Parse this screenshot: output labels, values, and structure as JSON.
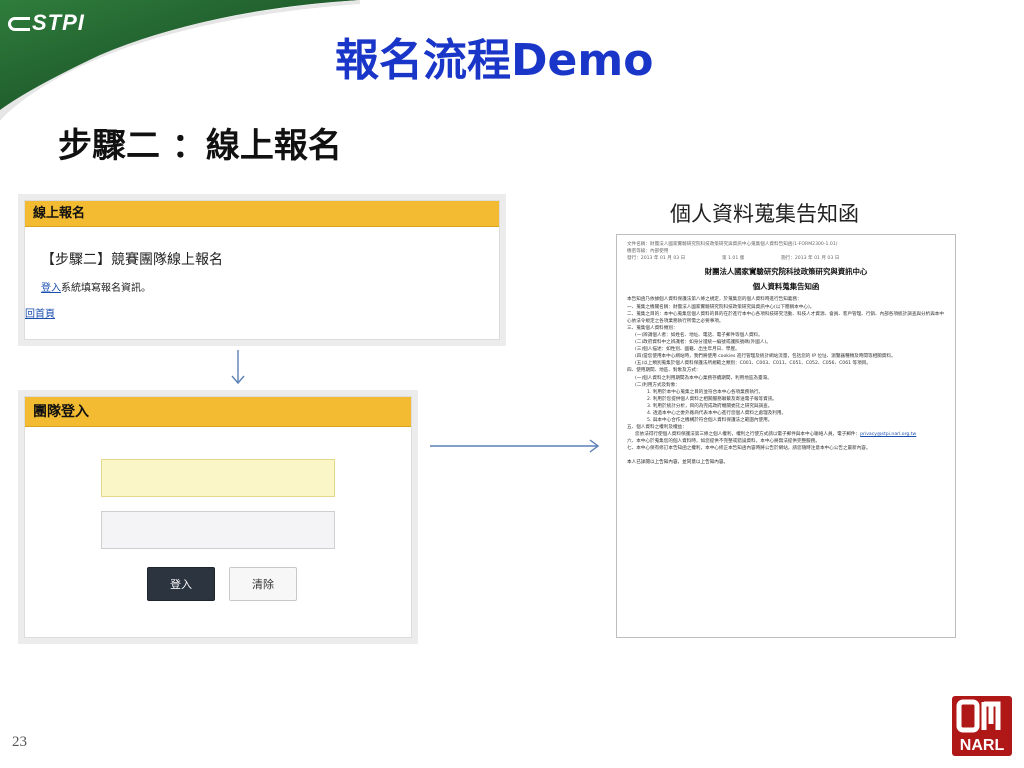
{
  "logo": {
    "text": "STPI"
  },
  "slide": {
    "title": "報名流程Demo",
    "step_title": "步驟二 ：線上報名",
    "page_number": "23"
  },
  "registration_panel": {
    "header": "線上報名",
    "heading": "【步驟二】競賽團隊線上報名",
    "login_link": "登入",
    "instruction": "系統填寫報名資訊。",
    "home_link": "回首頁"
  },
  "login_panel": {
    "header": "團隊登入",
    "username_value": "",
    "password_value": "",
    "login_button": "登入",
    "clear_button": "清除"
  },
  "document": {
    "caption": "個人資料蒐集告知函",
    "meta_line1": "文件名稱：財團法人國家實驗研究院科技政策研究與資訊中心蒐集個人資料告知函(1-FORM2300-1.01)",
    "meta_line2": "機密等級：內部使用",
    "meta_line3": "發行：2013 年 01 月 03 日　　　　　　　　第 1.01 版　　　　　　　　施行：2013 年 01 月 03 日",
    "org_title": "財團法人國家實驗研究院科技政策研究與資訊中心",
    "doc_title": "個人資料蒐集告知函",
    "intro": "本告知函乃依據個人資料保護法第八條之規定，於蒐集您的個人資料時進行告知義務：",
    "item1": "一、蒐集之機關名稱：財團法人國家實驗研究院科技政策研究與資訊中心(以下簡稱本中心)。",
    "item2": "二、蒐集之目的：本中心蒐集您個人資料的目的在於進行本中心各項科技研究活動、科技人才資源、會員、客戶管理、行銷、內部各項統計調查與分析與本中心依法令規定之各項業務執行所需之必要事項。",
    "item3": "三、蒐集個人資料類別：",
    "item3_1": "(一)辨識個人者：如姓名、地址、電話、電子郵件等個人資料。",
    "item3_2": "(二)政府資料中之辨識者：如身分證統一編號或護照號碼(外國人)。",
    "item3_3": "(三)個人描述：如性別、國籍、出生年月日、學歷。",
    "item3_4": "(四)當您使用本中心網站時，我們將使用 cookies 進行管理及統計網站流量，包括您的 IP 位址、瀏覽器種類及時間等相關資料。",
    "item3_5": "(五)以上類別蒐集於個人資料保護法所規範之類別：C001、C003、C011、C051、C052、C056、C061 等項目。",
    "item4": "四、使用期間、地區、對象及方式：",
    "item4_1": "(一)個人資料之利用期間為本中心業務存續期間，利用地區為臺灣。",
    "item4_2": "(二)利用方式及對象：",
    "item4_2_1": "1. 利用於本中心蒐集之目的並符合本中心各項業務執行。",
    "item4_2_2": "2. 利用於您提供個人資料之相關服務聯繫及寄送電子報等資訊。",
    "item4_2_3": "3. 利用於統計分析，目的為完成政府機關委託之研究與調查。",
    "item4_2_4": "4. 透過本中心之委外廠商代表本中心進行您個人資料之處理及利用。",
    "item4_2_5": "5. 與本中心合作之機構於符合個人資料保護法之範圍內使用。",
    "item5": "五、個人資料之權利及權益：",
    "item5_1": "您依法得行使個人資料保護法第三條之個人權利，權利之行使方式請以電子郵件與本中心聯絡人員，電子郵件：",
    "privacy_email": "privacy@stpi.narl.org.tw",
    "item6": "六、本中心於蒐集您的個人資料時，如您提供不完整或錯誤資料，本中心將無法提供完整服務。",
    "item7": "七、本中心保有修訂本告知函之權利，本中心修正本告知函內容時將公告於網站，請您隨時注意本中心公告之最新內容。",
    "footer": "本人已詳閱以上告知內容，並同意以上告知內容。"
  },
  "narl_logo": {
    "text": "NARL"
  },
  "colors": {
    "title_blue": "#1a36c8",
    "panel_header_orange": "#f3bb31",
    "corner_green": "#1f5e2e",
    "link_blue": "#1a4fb0",
    "narl_red": "#b01818"
  }
}
